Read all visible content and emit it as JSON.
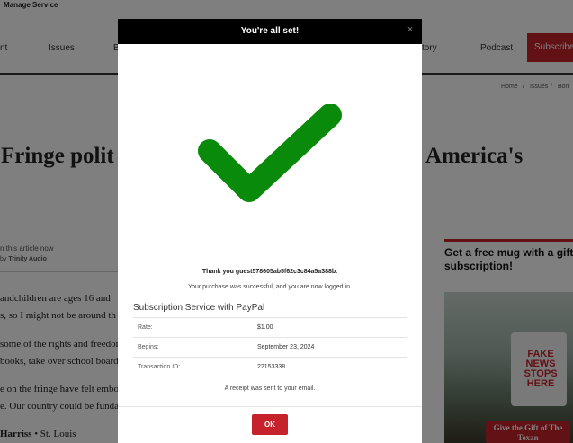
{
  "topbar": {
    "label": "Manage Service"
  },
  "nav": {
    "items": [
      "nt",
      "Issues",
      "B",
      "tory",
      "Podcast"
    ],
    "subscribe": "Subscribe"
  },
  "breadcrumb": [
    "Home",
    "/",
    "Issues",
    "/",
    "Borr"
  ],
  "article": {
    "headline_left": "Fringe polit",
    "headline_right": "e America's",
    "listen_line": "n this article now",
    "listen_by": "by",
    "listen_provider": "Trinity Audio",
    "paragraphs": [
      "andchildren are ages 16 and",
      "s, so I might not be around th",
      "some of the rights and freedon",
      "books, take over school boards",
      "e on the fringe have felt embo",
      "e. Our country could be funda"
    ],
    "author": "Harriss",
    "author_location": "• St. Louis"
  },
  "promo": {
    "title": "Get a free mug with a gift subscription!",
    "mug_text": "FAKE NEWS STOPS HERE",
    "gift_button": "Give the Gift of The Texan"
  },
  "modal": {
    "title": "You're all set!",
    "close": "×",
    "icon": "checkmark-icon",
    "thanks": "Thank you guest578605ab5f62c3c84a5a388b.",
    "success": "Your purchase was successful, and you are now logged in.",
    "service_title": "Subscription Service with PayPal",
    "rows": [
      {
        "label": "Rate:",
        "value": "$1.00"
      },
      {
        "label": "Begins:",
        "value": "September 23, 2024"
      },
      {
        "label": "Transaction ID:",
        "value": "22153338"
      }
    ],
    "receipt": "A receipt was sent to your email.",
    "ok": "OK"
  },
  "colors": {
    "accent": "#c5222b",
    "check": "#0a8a0a",
    "header": "#000000"
  }
}
